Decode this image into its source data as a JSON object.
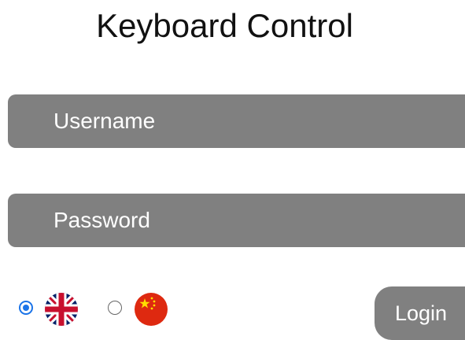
{
  "header": {
    "title": "Keyboard Control"
  },
  "form": {
    "username_placeholder": "Username",
    "username_value": "",
    "password_placeholder": "Password",
    "password_value": "",
    "login_label": "Login"
  },
  "language": {
    "options": [
      {
        "icon": "uk-flag-icon",
        "selected": true
      },
      {
        "icon": "china-flag-icon",
        "selected": false
      }
    ]
  },
  "colors": {
    "field_background": "#808080",
    "field_text": "#ffffff",
    "radio_accent": "#1a73e8",
    "uk_blue": "#012169",
    "uk_red": "#C8102E",
    "china_red": "#DE2910",
    "china_yellow": "#FFDE00"
  }
}
